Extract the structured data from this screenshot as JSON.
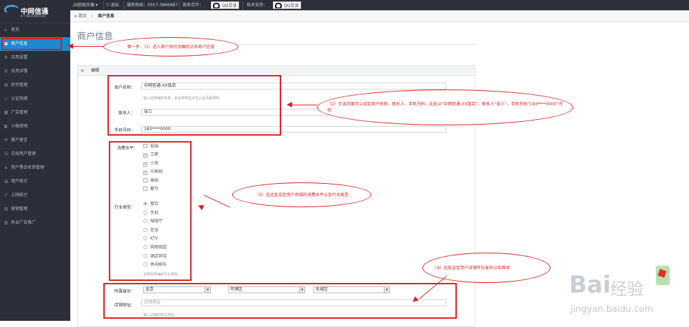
{
  "logo": {
    "brand": "中网信通",
    "sub": "ICT INFORMATION"
  },
  "sidebar": {
    "items": [
      {
        "label": "首页",
        "icon": "home-icon"
      },
      {
        "label": "商户信息",
        "icon": "shop-icon"
      },
      {
        "label": "应用设置",
        "icon": "settings-icon"
      },
      {
        "label": "应用详情",
        "icon": "detail-icon"
      },
      {
        "label": "后台管理",
        "icon": "admin-icon"
      },
      {
        "label": "认证页面",
        "icon": "auth-icon"
      },
      {
        "label": "广告管理",
        "icon": "ad-icon"
      },
      {
        "label": "小微官网",
        "icon": "web-icon"
      },
      {
        "label": "客户留言",
        "icon": "message-icon"
      },
      {
        "label": "在线用户管理",
        "icon": "user-icon"
      },
      {
        "label": "用户黑白名单管理",
        "icon": "list-icon"
      },
      {
        "label": "用户统计",
        "icon": "stats-icon"
      },
      {
        "label": "上网统计",
        "icon": "chart-icon"
      },
      {
        "label": "营销管理",
        "icon": "marketing-icon"
      },
      {
        "label": "异业广告推广",
        "icon": "promo-icon"
      }
    ]
  },
  "topbar": {
    "account": "zb欧姐夫偏 ▾",
    "logout": "⎋ 退出",
    "hotline": "服务热线：0557-3866887",
    "business": "商务合作：",
    "qq1": "QQ交谈",
    "tech": "技术支持：",
    "qq2": "QQ交谈"
  },
  "breadcrumb": {
    "home": "首页",
    "sep": "›",
    "current": "商户信息"
  },
  "page": {
    "title": "商户信息",
    "panel_title": "编辑"
  },
  "form": {
    "merchant_name_label": "商户名称：",
    "merchant_name": "中网信通-XX饭店",
    "merchant_hint": "输入店商铺的名称，会名称将显示在认证页面顶部。",
    "contact_label": "联系人：",
    "contact": "张三",
    "phone_label": "手机号码：",
    "phone": "183****0000",
    "consume_label": "消费水平：",
    "consume_options": [
      {
        "label": "低端",
        "checked": false
      },
      {
        "label": "工薪",
        "checked": true
      },
      {
        "label": "小资",
        "checked": true
      },
      {
        "label": "中高档",
        "checked": true
      },
      {
        "label": "高档",
        "checked": false
      },
      {
        "label": "奢华",
        "checked": false
      }
    ],
    "industry_label": "行业类型：",
    "industry_options": [
      {
        "label": "餐饮",
        "checked": true
      },
      {
        "label": "手机",
        "checked": false
      },
      {
        "label": "咖啡厅",
        "checked": false
      },
      {
        "label": "足浴",
        "checked": false
      },
      {
        "label": "KTV",
        "checked": false
      },
      {
        "label": "购物商超",
        "checked": false
      },
      {
        "label": "酒店宾馆",
        "checked": false
      },
      {
        "label": "休闲娱乐",
        "checked": false
      }
    ],
    "industry_hint": "选择您商铺的行业类型",
    "region_label": "所属省份：",
    "province": "北京",
    "city": "市辖区",
    "district": "东城区",
    "address_label": "店铺地址：",
    "address_placeholder": "店铺地址",
    "address_hint": "输入店铺的所在地址。"
  },
  "annotations": {
    "step1": "第一步，（1）进入商户后台页面后点击商户信息",
    "step2": "（2）在该页面可以设定商户名称、联系人、手机号码，此处以“中网信通-XX饭店”，联系人“张三”，手机号码“183****0000”为例",
    "step3": "（3）在此处设定用户商铺的消费水平以及行业类型",
    "step4": "（4）此处设定用户店铺所在省市以及具体"
  },
  "watermark": {
    "logo_a": "Bai",
    "logo_b": "经验",
    "url": "jingyan.baidu.com"
  },
  "colors": {
    "sidebar": "#2b2f3a",
    "active": "#1e88d0",
    "annotation": "#e01e1e"
  }
}
